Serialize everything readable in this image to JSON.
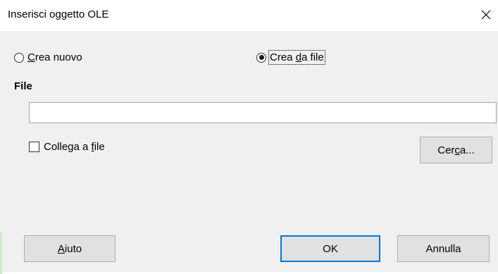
{
  "window": {
    "title": "Inserisci oggetto OLE",
    "close_icon": "close-icon"
  },
  "options": {
    "create_new": {
      "prefix": "",
      "accel": "C",
      "rest": "rea nuovo",
      "checked": false
    },
    "create_from_file": {
      "prefix": "Crea ",
      "accel": "d",
      "rest": "a file",
      "checked": true
    }
  },
  "file_section": {
    "label": "File",
    "value": "",
    "placeholder": ""
  },
  "link_checkbox": {
    "prefix": "Collega a ",
    "accel": "f",
    "rest": "ile",
    "checked": false
  },
  "buttons": {
    "browse": {
      "prefix": "Cer",
      "accel": "c",
      "rest": "a..."
    },
    "help": {
      "prefix": "",
      "accel": "A",
      "rest": "iuto"
    },
    "ok": {
      "label": "OK"
    },
    "cancel": {
      "label": "Annulla"
    }
  },
  "colors": {
    "dialog_bg": "#f0f0f0",
    "title_bg": "#ffffff",
    "default_button_border": "#0078d7"
  }
}
